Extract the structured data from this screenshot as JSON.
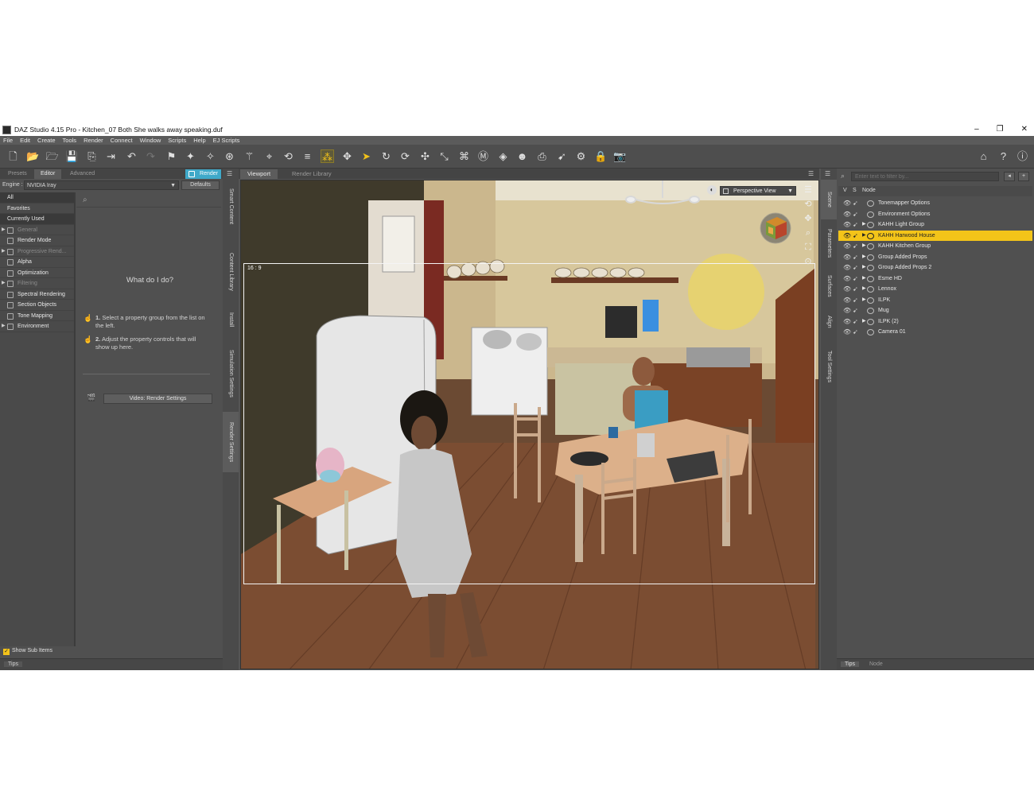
{
  "window": {
    "title": "DAZ Studio 4.15 Pro - Kitchen_07 Both She walks away speaking.duf",
    "minimize": "–",
    "restore": "❐",
    "close": "✕"
  },
  "menu": [
    "File",
    "Edit",
    "Create",
    "Tools",
    "Render",
    "Connect",
    "Window",
    "Scripts",
    "Help",
    "EJ Scripts"
  ],
  "left_pane": {
    "tabs": [
      "Presets",
      "Editor",
      "Advanced"
    ],
    "active_tab": "Editor",
    "render_button": "Render",
    "engine_label": "Engine :",
    "engine_value": "NVIDIA Iray",
    "defaults_button": "Defaults",
    "property_groups": [
      {
        "label": "All",
        "selected": true
      },
      {
        "label": "Favorites"
      },
      {
        "label": "Currently Used",
        "selected": true
      },
      {
        "label": "General",
        "dim": true,
        "expander": true
      },
      {
        "label": "Render Mode"
      },
      {
        "label": "Progressive Rend...",
        "dim": true,
        "expander": true
      },
      {
        "label": "Alpha"
      },
      {
        "label": "Optimization"
      },
      {
        "label": "Filtering",
        "dim": true,
        "expander": true
      },
      {
        "label": "Spectral Rendering"
      },
      {
        "label": "Section Objects"
      },
      {
        "label": "Tone Mapping"
      },
      {
        "label": "Environment",
        "expander": true
      }
    ],
    "help_title": "What do I do?",
    "step1_num": "1.",
    "step1_text": "Select a property group from the list on the left.",
    "step2_num": "2.",
    "step2_text": "Adjust the property controls that will show up here.",
    "video_button": "Video: Render Settings",
    "show_sub_items": "Show Sub Items",
    "tips_tab": "Tips"
  },
  "left_side_tabs": [
    "Smart Content",
    "Content Library",
    "Install",
    "Simulation Settings",
    "Render Settings"
  ],
  "center": {
    "tabs": [
      "Viewport",
      "Render Library"
    ],
    "active_tab": "Viewport",
    "aspect_label": "16 : 9",
    "view_menu": "Perspective View"
  },
  "right_side_tabs": [
    "Scene",
    "Parameters",
    "Surfaces",
    "Align",
    "Tool Settings"
  ],
  "scene_pane": {
    "filter_placeholder": "Enter text to filter by...",
    "col_v": "V",
    "col_s": "S",
    "col_node": "Node",
    "nodes": [
      {
        "label": "Tonemapper Options"
      },
      {
        "label": "Environment Options"
      },
      {
        "label": "KAHH Light Group",
        "expander": true
      },
      {
        "label": "KAHH Harwood House",
        "expander": true,
        "selected": true
      },
      {
        "label": "KAHH Kitchen Group",
        "expander": true
      },
      {
        "label": "Group Added Props",
        "expander": true
      },
      {
        "label": "Group Added Props 2",
        "expander": true
      },
      {
        "label": "Esme HD",
        "expander": true
      },
      {
        "label": "Lennox",
        "expander": true
      },
      {
        "label": "ILPK",
        "expander": true
      },
      {
        "label": "Mug"
      },
      {
        "label": "ILPK (2)",
        "expander": true
      },
      {
        "label": "Camera 01"
      }
    ],
    "bottom_tabs": [
      "Tips",
      "Node"
    ],
    "active_bottom_tab": "Tips"
  },
  "colors": {
    "accent_yellow": "#f3c419",
    "render_blue": "#3fa9c9",
    "panel_bg": "#505050"
  }
}
